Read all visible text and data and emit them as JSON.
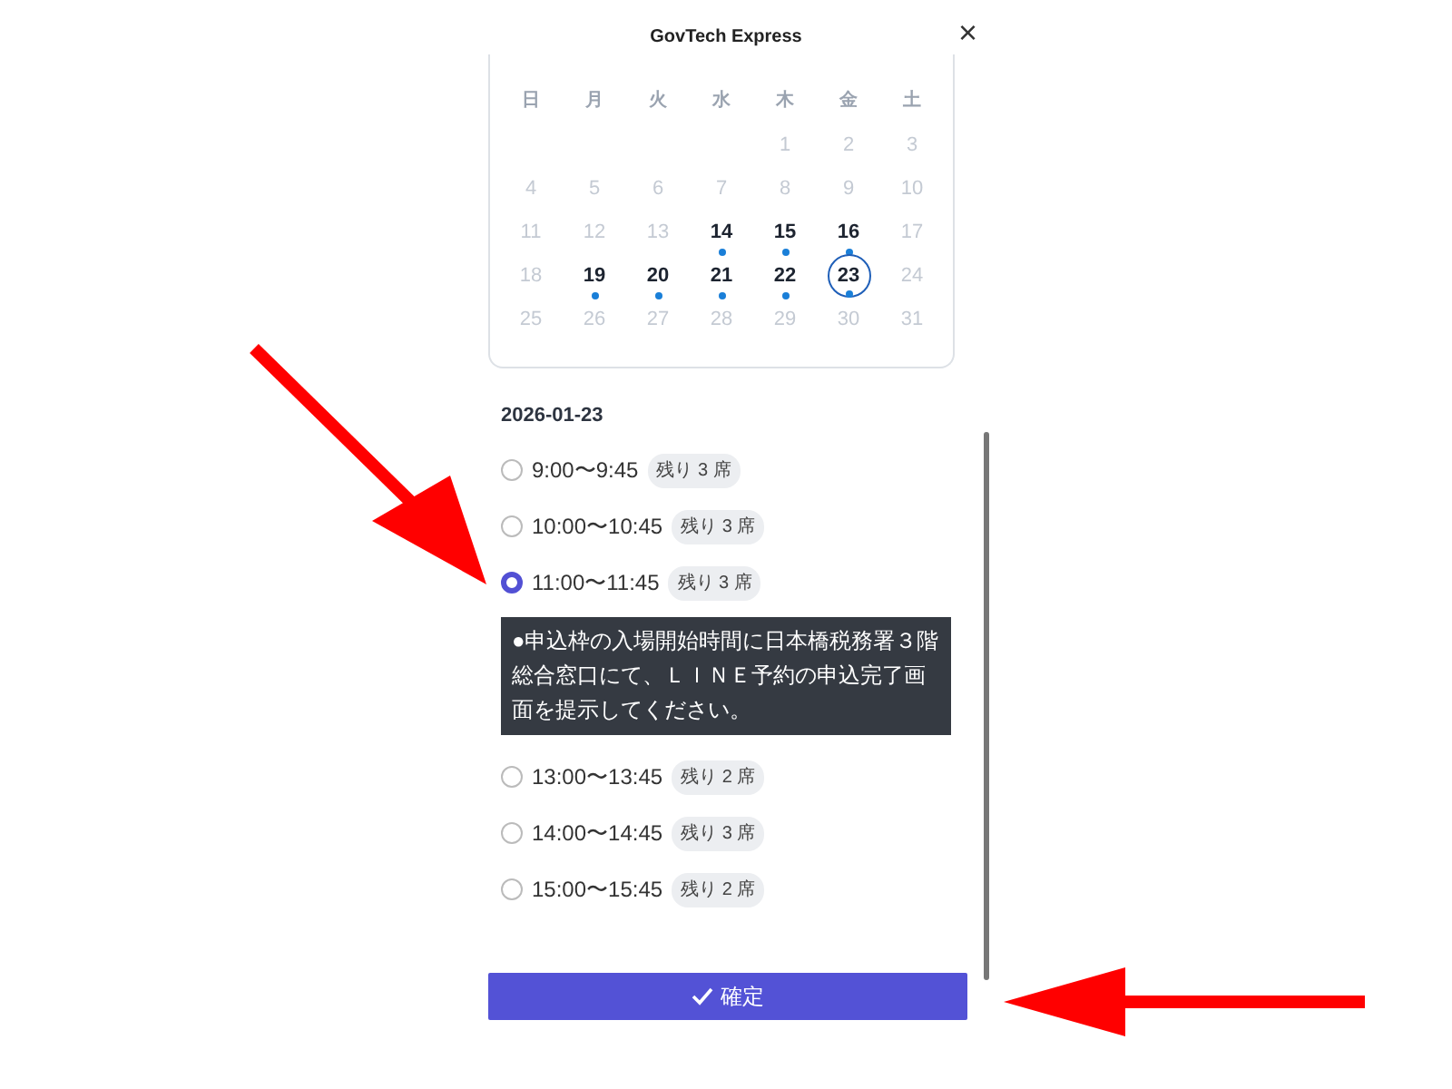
{
  "header": {
    "title": "GovTech Express",
    "close": "×"
  },
  "calendar": {
    "weekdays": [
      "日",
      "月",
      "火",
      "水",
      "木",
      "金",
      "土"
    ],
    "weeks": [
      [
        {
          "day": "1",
          "available": false,
          "selected": false
        },
        {
          "day": "2",
          "available": false,
          "selected": false
        },
        {
          "day": "3",
          "available": false,
          "selected": false
        }
      ],
      [
        {
          "day": "4",
          "available": false,
          "selected": false
        },
        {
          "day": "5",
          "available": false,
          "selected": false
        },
        {
          "day": "6",
          "available": false,
          "selected": false
        },
        {
          "day": "7",
          "available": false,
          "selected": false
        },
        {
          "day": "8",
          "available": false,
          "selected": false
        },
        {
          "day": "9",
          "available": false,
          "selected": false
        },
        {
          "day": "10",
          "available": false,
          "selected": false
        }
      ],
      [
        {
          "day": "11",
          "available": false,
          "selected": false
        },
        {
          "day": "12",
          "available": false,
          "selected": false
        },
        {
          "day": "13",
          "available": false,
          "selected": false
        },
        {
          "day": "14",
          "available": true,
          "selected": false
        },
        {
          "day": "15",
          "available": true,
          "selected": false
        },
        {
          "day": "16",
          "available": true,
          "selected": false
        },
        {
          "day": "17",
          "available": false,
          "selected": false
        }
      ],
      [
        {
          "day": "18",
          "available": false,
          "selected": false
        },
        {
          "day": "19",
          "available": true,
          "selected": false
        },
        {
          "day": "20",
          "available": true,
          "selected": false
        },
        {
          "day": "21",
          "available": true,
          "selected": false
        },
        {
          "day": "22",
          "available": true,
          "selected": false
        },
        {
          "day": "23",
          "available": true,
          "selected": true
        },
        {
          "day": "24",
          "available": false,
          "selected": false
        }
      ],
      [
        {
          "day": "25",
          "available": false,
          "selected": false
        },
        {
          "day": "26",
          "available": false,
          "selected": false
        },
        {
          "day": "27",
          "available": false,
          "selected": false
        },
        {
          "day": "28",
          "available": false,
          "selected": false
        },
        {
          "day": "29",
          "available": false,
          "selected": false
        },
        {
          "day": "30",
          "available": false,
          "selected": false
        },
        {
          "day": "31",
          "available": false,
          "selected": false
        }
      ]
    ]
  },
  "date_heading": "2026-01-23",
  "slots": [
    {
      "time": "9:00〜9:45",
      "remaining": "残り 3 席",
      "selected": false
    },
    {
      "time": "10:00〜10:45",
      "remaining": "残り 3 席",
      "selected": false
    },
    {
      "time": "11:00〜11:45",
      "remaining": "残り 3 席",
      "selected": true,
      "note": "●申込枠の入場開始時間に日本橋税務署３階総合窓口にて、ＬＩＮＥ予約の申込完了画面を提示してください。"
    },
    {
      "time": "13:00〜13:45",
      "remaining": "残り 2 席",
      "selected": false
    },
    {
      "time": "14:00〜14:45",
      "remaining": "残り 3 席",
      "selected": false
    },
    {
      "time": "15:00〜15:45",
      "remaining": "残り 2 席",
      "selected": false
    }
  ],
  "confirm_button": "確定"
}
